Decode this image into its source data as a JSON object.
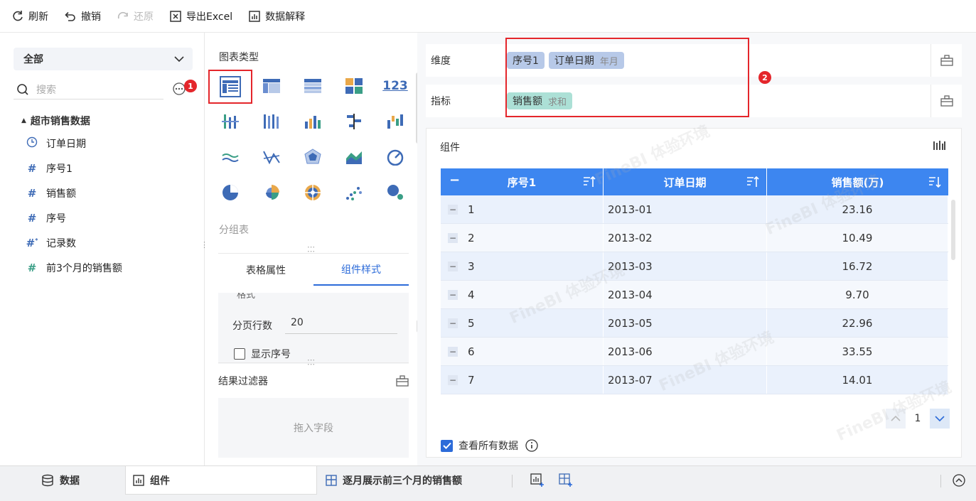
{
  "toolbar": {
    "refresh": "刷新",
    "undo": "撤销",
    "redo": "还原",
    "export_excel": "导出Excel",
    "data_explain": "数据解释"
  },
  "left": {
    "scope": "全部",
    "search_placeholder": "搜索",
    "badge1": "1",
    "dataset": "超市销售数据",
    "fields": [
      {
        "label": "订单日期",
        "icon": "clock-icon"
      },
      {
        "label": "序号1",
        "icon": "hash-icon"
      },
      {
        "label": "销售额",
        "icon": "hash-icon"
      },
      {
        "label": "序号",
        "icon": "hash-icon"
      },
      {
        "label": "记录数",
        "icon": "hash-star-icon"
      },
      {
        "label": "前3个月的销售额",
        "icon": "calc-field-icon"
      }
    ]
  },
  "mid": {
    "chart_type_title": "图表类型",
    "group_label": "分组表",
    "tabs": [
      "表格属性",
      "组件样式"
    ],
    "cut_text": "格式",
    "page_rows_label": "分页行数",
    "page_rows_value": "20",
    "show_index_label": "显示序号",
    "filter_title": "结果过滤器",
    "filter_drop": "拖入字段"
  },
  "right": {
    "dimension_label": "维度",
    "measure_label": "指标",
    "dim_pills": [
      {
        "name": "序号1",
        "sub": ""
      },
      {
        "name": "订单日期",
        "sub": "年月"
      }
    ],
    "measure_pills": [
      {
        "name": "销售额",
        "sub": "求和"
      }
    ],
    "badge2": "2",
    "component_title": "组件",
    "table": {
      "headers": [
        "序号1",
        "订单日期",
        "销售额(万)"
      ],
      "header_minus": "−",
      "rows": [
        [
          "1",
          "2013-01",
          "23.16"
        ],
        [
          "2",
          "2013-02",
          "10.49"
        ],
        [
          "3",
          "2013-03",
          "16.72"
        ],
        [
          "4",
          "2013-04",
          "9.70"
        ],
        [
          "5",
          "2013-05",
          "22.96"
        ],
        [
          "6",
          "2013-06",
          "33.55"
        ],
        [
          "7",
          "2013-07",
          "14.01"
        ]
      ]
    },
    "page_number": "1",
    "view_all_label": "查看所有数据",
    "watermark": "FineBI 体验环境"
  },
  "bottom": {
    "data_tab": "数据",
    "component_tab": "组件",
    "dashboard_tab": "逐月展示前三个月的销售额"
  },
  "colors": {
    "accent": "#2c6bd9",
    "header_blue": "#3d86f0",
    "highlight_red": "#e4262b",
    "dim_pill": "#b7c9e8",
    "measure_pill": "#ace0d6"
  }
}
